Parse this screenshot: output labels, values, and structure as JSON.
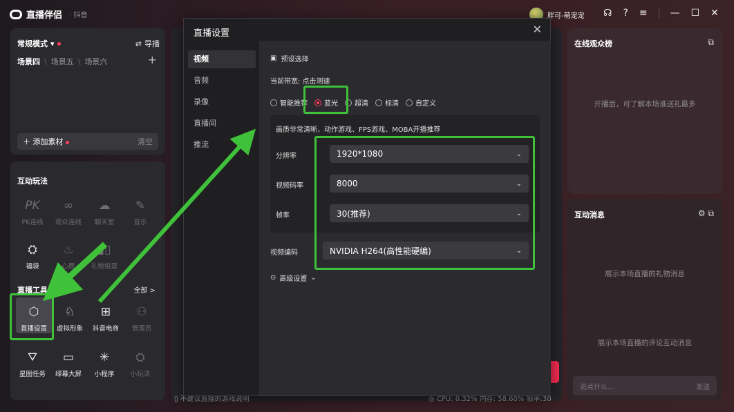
{
  "titlebar": {
    "app_name": "直播伴侣",
    "platform": "· 抖音",
    "user_name": "胖可-萌宠宠"
  },
  "scene_panel": {
    "mode": "常规模式",
    "guide": "导播",
    "scenes": [
      "场景四",
      "场景五",
      "场景六"
    ],
    "add_material": "添加素材",
    "clear": "清空"
  },
  "interact_panel": {
    "title": "互动玩法",
    "games": [
      {
        "label": "PK连线",
        "icon": "pk-icon"
      },
      {
        "label": "观众连线",
        "icon": "link-icon"
      },
      {
        "label": "聊天室",
        "icon": "chat-room-icon"
      },
      {
        "label": "音乐",
        "icon": "music-icon"
      },
      {
        "label": "福袋",
        "icon": "lucky-bag-icon"
      },
      {
        "label": "心愿",
        "icon": "wish-icon"
      },
      {
        "label": "礼物投票",
        "icon": "gift-vote-icon"
      }
    ],
    "tools_title": "直播工具",
    "all_label": "全部 >",
    "tools": [
      {
        "label": "直播设置",
        "icon": "live-settings-icon"
      },
      {
        "label": "虚拟形象",
        "icon": "avatar-icon"
      },
      {
        "label": "抖音电商",
        "icon": "cart-icon"
      },
      {
        "label": "管理员",
        "icon": "admin-icon"
      },
      {
        "label": "星图任务",
        "icon": "star-task-icon"
      },
      {
        "label": "绿幕大屏",
        "icon": "green-screen-icon"
      },
      {
        "label": "小程序",
        "icon": "mini-program-icon"
      },
      {
        "label": "小玩法",
        "icon": "mini-game-icon"
      }
    ]
  },
  "center": {
    "bottom_hint": "不建议直播的游戏说明",
    "status": "CPU: 0.32%   内存: 58.60%   帧率:30"
  },
  "right": {
    "viewers_title": "在线观众榜",
    "viewers_hint": "开播后，可了解本场谁送礼最多",
    "messages_title": "互动消息",
    "gift_hint": "展示本场直播的礼物消息",
    "comment_hint": "展示本场直播的评论互动消息",
    "input_placeholder": "说点什么...",
    "send": "发送"
  },
  "dialog": {
    "title": "直播设置",
    "nav": [
      "视频",
      "音频",
      "录像",
      "直播间",
      "推流"
    ],
    "preset_label": "预设选择",
    "bandwidth": "当前带宽: 点击测速",
    "quality_options": [
      "智能推荐",
      "蓝光",
      "超清",
      "标清",
      "自定义"
    ],
    "selected_quality": "蓝光",
    "quality_desc": "画质非常清晰，动作游戏、FPS游戏、MOBA开播推荐",
    "resolution_label": "分辨率",
    "resolution": "1920*1080",
    "bitrate_label": "视频码率",
    "bitrate": "8000",
    "fps_label": "帧率",
    "fps": "30(推荐)",
    "encoder_label": "视频编码",
    "encoder": "NVIDIA H264(高性能硬编)",
    "advanced": "高级设置"
  },
  "colors": {
    "accent": "#ff3d5a",
    "annotation_green": "#3fc23a"
  }
}
